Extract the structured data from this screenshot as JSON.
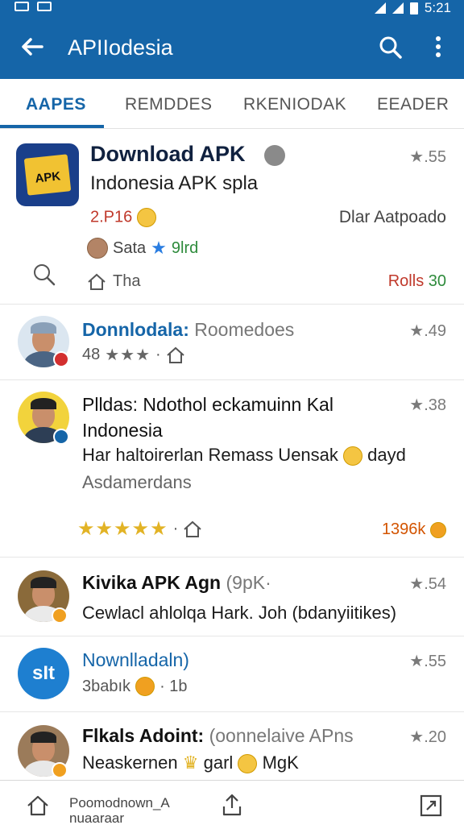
{
  "status": {
    "time": "5:21"
  },
  "app_bar": {
    "title": "APIIodesia"
  },
  "tabs": [
    {
      "label": "AAPES"
    },
    {
      "label": "REMDDES"
    },
    {
      "label": "RKENIODAK"
    },
    {
      "label": "EEADER"
    }
  ],
  "featured": {
    "icon_text": "APK",
    "title": "Download APK",
    "rating": "★.55",
    "subtitle": "Indonesia APK spla",
    "price": "2.P16",
    "developer": "Dlar Aatpoado",
    "author": "Sata",
    "author_badge": "9lrd",
    "location": "Tha",
    "rolls_label": "Rolls",
    "rolls_value": "30"
  },
  "rows": [
    {
      "title": "Donnlodala:",
      "title_extra": "Roomedoes",
      "rating": "★.49",
      "meta_prefix": "48",
      "stars": "★★★",
      "dot": "·",
      "colors": {
        "avatar_bg": "#dbe6f0",
        "badge": "#d32f2f"
      }
    },
    {
      "title": "Plldas: Ndothol eckamuinn Kal Indonesia",
      "rating": "★.38",
      "line1": "Har haltoirerlan Remass Uensak",
      "line1_end": "dayd",
      "line2": "Asdamerdans",
      "stars": "★★★★★",
      "count": "1396k",
      "colors": {
        "avatar_bg": "#f2d33c",
        "badge": "#1565a8"
      }
    },
    {
      "title": "Kivika APK Agn",
      "title_extra": "(9pK·",
      "rating": "★.54",
      "line1": "Cewlacl ahlolqa Hark. Joh (bdanyiitikes)",
      "colors": {
        "avatar_bg": "#8a6a3a",
        "badge": "#f0a020"
      }
    },
    {
      "title": "Nownlladaln)",
      "rating": "★.55",
      "meta_prefix": "3babık",
      "meta_suffix": "· 1b",
      "icon_text": "sIt",
      "colors": {
        "avatar_bg": "#1e7fd0"
      }
    },
    {
      "title": "Flkals Adoint:",
      "title_extra": "(oonnelaive APns",
      "rating": "★.20",
      "line1": "Neaskernen",
      "line1_mid": "garl",
      "line1_end": "MgK",
      "colors": {
        "avatar_bg": "#9b7b5a",
        "badge": "#f0a020"
      }
    }
  ],
  "bottom_nav": {
    "label": "Poomodnown_A nuaaraar"
  },
  "colors": {
    "primary": "#1565a8",
    "active_tab": "#1565a8",
    "price_red": "#c0392b",
    "green": "#2e8b3c",
    "gold": "#e2b325"
  }
}
